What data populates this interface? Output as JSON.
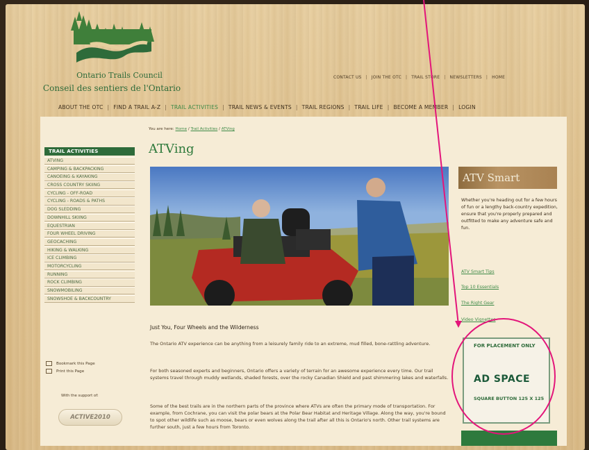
{
  "site": {
    "org_name": "Ontario Trails Council",
    "org_name_fr": "Conseil des sentiers de l'Ontario"
  },
  "utility_nav": [
    "CONTACT US",
    "JOIN THE OTC",
    "TRAIL STORE",
    "NEWSLETTERS",
    "HOME"
  ],
  "main_nav": {
    "items": [
      "ABOUT THE OTC",
      "FIND A TRAIL A-Z",
      "TRAIL ACTIVITIES",
      "TRAIL NEWS & EVENTS",
      "TRAIL REGIONS",
      "TRAIL LIFE",
      "BECOME A MEMBER",
      "LOGIN"
    ],
    "active": "TRAIL ACTIVITIES"
  },
  "breadcrumb": {
    "prefix": "You are here:",
    "home": "Home",
    "trail_activities": "Trail Activities",
    "current": "ATVing",
    "sep": "/"
  },
  "page_title": "ATVing",
  "sidebar": {
    "heading": "TRAIL ACTIVITIES",
    "items": [
      "ATVING",
      "CAMPING & BACKPACKING",
      "CANOEING & KAYAKING",
      "CROSS COUNTRY SKIING",
      "CYCLING - OFF-ROAD",
      "CYCLING - ROADS & PATHS",
      "DOG SLEDDING",
      "DOWNHILL SKIING",
      "EQUESTRIAN",
      "FOUR WHEEL DRIVING",
      "GEOCACHING",
      "HIKING & WALKING",
      "ICE CLIMBING",
      "MOTORCYCLING",
      "RUNNING",
      "ROCK CLIMBING",
      "SNOWMOBILING",
      "SNOWSHOE & BACKCOUNTRY"
    ],
    "bookmark": "Bookmark this Page",
    "print": "Print this Page",
    "support_label": "With the support of:",
    "sponsor": "ACTIVE2010"
  },
  "article": {
    "heading": "Just You, Four Wheels and the Wilderness",
    "paragraphs": [
      "The Ontario ATV experience can be anything from a leisurely family ride to an extreme, mud filled, bone-rattling adventure.",
      "For both seasoned experts and beginners, Ontario offers a variety of terrain for an awesome experience every time. Our trail systems travel through muddy wetlands, shaded forests, over the rocky Canadian Shield and past shimmering lakes and waterfalls.",
      "Some of the best trails are in the northern parts of the province where ATVs are often the primary mode of transportation. For example, from Cochrane, you can visit the polar bears at the Polar Bear Habitat and Heritage Village. Along the way, you're bound to spot other wildlife such as moose, bears or even wolves along the trail after all this is Ontario's north. Other trail systems are further south, just a few hours from Toronto."
    ]
  },
  "atv_smart": {
    "banner": "ATV Smart",
    "text": "Whether you're heading out for a few hours of fun or a lengthy back-country expedition, ensure that you're properly prepared and outfitted to make any adventure safe and fun.",
    "links": [
      "ATV Smart Tips",
      "Top 10 Essentials",
      "The Right Gear",
      "Video Vignettes"
    ]
  },
  "ad": {
    "top": "FOR PLACEMENT ONLY",
    "main": "AD SPACE",
    "bottom": "SQUARE BUTTON 125 X 125"
  },
  "colors": {
    "brand_green": "#2e6b3a",
    "link_green": "#3e8a47",
    "annotation": "#e3157a"
  }
}
